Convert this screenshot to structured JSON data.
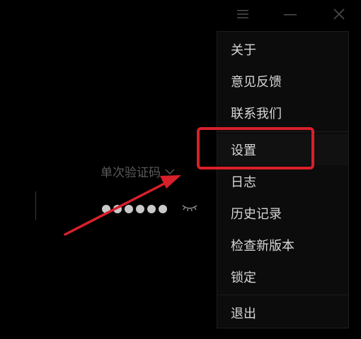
{
  "colors": {
    "background": "#000000",
    "menu_bg": "#0c0c0c",
    "menu_text": "#d6d6d6",
    "muted_text": "#5c5c5c",
    "annotation_red": "#d8202a"
  },
  "titlebar": {
    "icons": [
      "menu-icon",
      "minimize-icon",
      "close-icon"
    ]
  },
  "login": {
    "mode_label": "单次验证码",
    "mode_icon": "chevron-down-icon",
    "code_dot_count": 6,
    "visibility_icon": "eye-closed-icon"
  },
  "menu": {
    "items": [
      {
        "label": "关于"
      },
      {
        "label": "意见反馈"
      },
      {
        "label": "联系我们"
      },
      {
        "label": "设置"
      },
      {
        "label": "日志"
      },
      {
        "label": "历史记录"
      },
      {
        "label": "检查新版本"
      },
      {
        "label": "锁定"
      },
      {
        "label": "退出"
      }
    ]
  },
  "annotation": {
    "highlighted_item": "设置"
  }
}
